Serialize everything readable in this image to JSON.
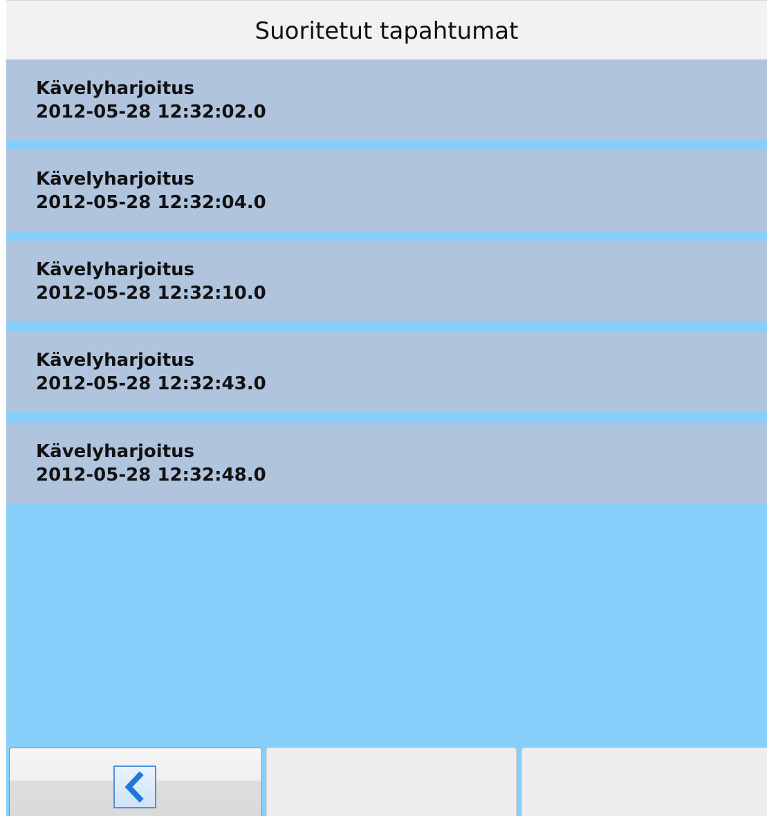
{
  "header": {
    "title": "Suoritetut tapahtumat"
  },
  "events": [
    {
      "name": "Kävelyharjoitus",
      "time": "2012-05-28 12:32:02.0"
    },
    {
      "name": "Kävelyharjoitus",
      "time": "2012-05-28 12:32:04.0"
    },
    {
      "name": "Kävelyharjoitus",
      "time": "2012-05-28 12:32:10.0"
    },
    {
      "name": "Kävelyharjoitus",
      "time": "2012-05-28 12:32:43.0"
    },
    {
      "name": "Kävelyharjoitus",
      "time": "2012-05-28 12:32:48.0"
    }
  ],
  "toolbar": {
    "back_icon": "chevron-left-icon",
    "button2_label": "",
    "button3_label": ""
  },
  "colors": {
    "background": "#87cefa",
    "item_background": "#b0c4de",
    "header_background": "#f2f2f2",
    "icon_accent": "#1f78d6"
  }
}
